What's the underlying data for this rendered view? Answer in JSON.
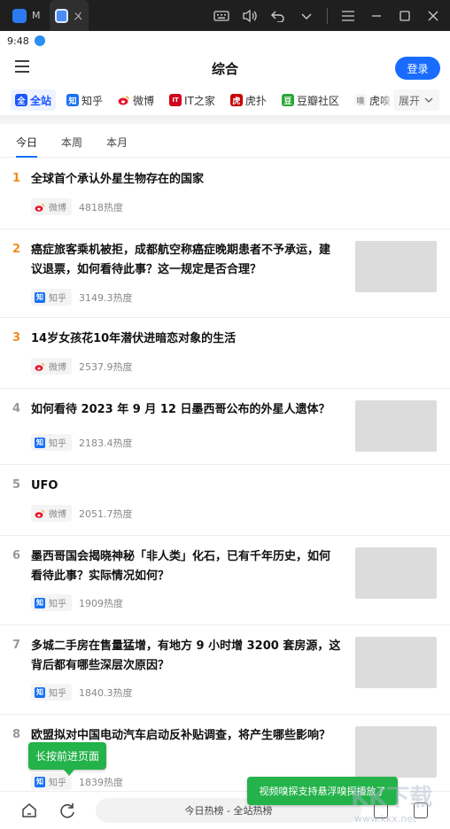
{
  "emulator": {
    "tab_label": "M",
    "tab2_label": "ㄨ"
  },
  "status_bar": {
    "time": "9:48"
  },
  "header": {
    "title": "综合",
    "login_label": "登录"
  },
  "sources": [
    {
      "label": "全站",
      "icon": "全",
      "color": "#1a56ff"
    },
    {
      "label": "知乎",
      "icon": "知",
      "color": "#1772f6"
    },
    {
      "label": "微博",
      "icon": "weibo-icon",
      "color": "#e6162d"
    },
    {
      "label": "IT之家",
      "icon": "IT",
      "color": "#d0021b"
    },
    {
      "label": "虎扑",
      "icon": "虎",
      "color": "#c60100"
    },
    {
      "label": "豆瓣社区",
      "icon": "豆",
      "color": "#2aa836"
    },
    {
      "label": "虎嗅",
      "icon": "嗅",
      "color": "#f5f5f5"
    }
  ],
  "expand_label": "展开",
  "periods": [
    "今日",
    "本周",
    "本月"
  ],
  "items": [
    {
      "rank": "1",
      "title": [
        "全球首个承认外星生物存在的国家"
      ],
      "source": "微博",
      "heat": "4818热度",
      "thumb": false
    },
    {
      "rank": "2",
      "title": [
        "癌症旅客乘机被拒，成都航空称癌症晚期患者不予承运，建",
        "议退票，如何看待此事？这一规定是否合理？"
      ],
      "source": "知乎",
      "heat": "3149.3热度",
      "thumb": true
    },
    {
      "rank": "3",
      "title": [
        "14岁女孩花10年潜伏进暗恋对象的生活"
      ],
      "source": "微博",
      "heat": "2537.9热度",
      "thumb": false
    },
    {
      "rank": "4",
      "title": [
        "如何看待 2023 年 9 月 12 日墨西哥公布的外星人遗体？"
      ],
      "source": "知乎",
      "heat": "2183.4热度",
      "thumb": true
    },
    {
      "rank": "5",
      "title": [
        "UFO"
      ],
      "source": "微博",
      "heat": "2051.7热度",
      "thumb": false
    },
    {
      "rank": "6",
      "title": [
        "墨西哥国会揭晓神秘「非人类」化石，已有千年历史，如何",
        "看待此事？实际情况如何？"
      ],
      "source": "知乎",
      "heat": "1909热度",
      "thumb": true
    },
    {
      "rank": "7",
      "title": [
        "多城二手房在售量猛增，有地方 9 小时增 3200 套房源，这",
        "背后都有哪些深层次原因？"
      ],
      "source": "知乎",
      "heat": "1840.3热度",
      "thumb": true
    },
    {
      "rank": "8",
      "title": [
        "欧盟拟对中国电动汽车启动反补贴调查，将产生哪些影响？",
        "关注？"
      ],
      "source": "知乎",
      "heat": "1839热度",
      "thumb": true
    }
  ],
  "bottom": {
    "address": "今日热榜 - 全站热榜"
  },
  "toasts": {
    "back": "长按前进页面",
    "video": "视频嗅探支持悬浮嗅探播放了"
  },
  "watermark": {
    "text": "KK下载",
    "url": "www.kkx.net"
  }
}
